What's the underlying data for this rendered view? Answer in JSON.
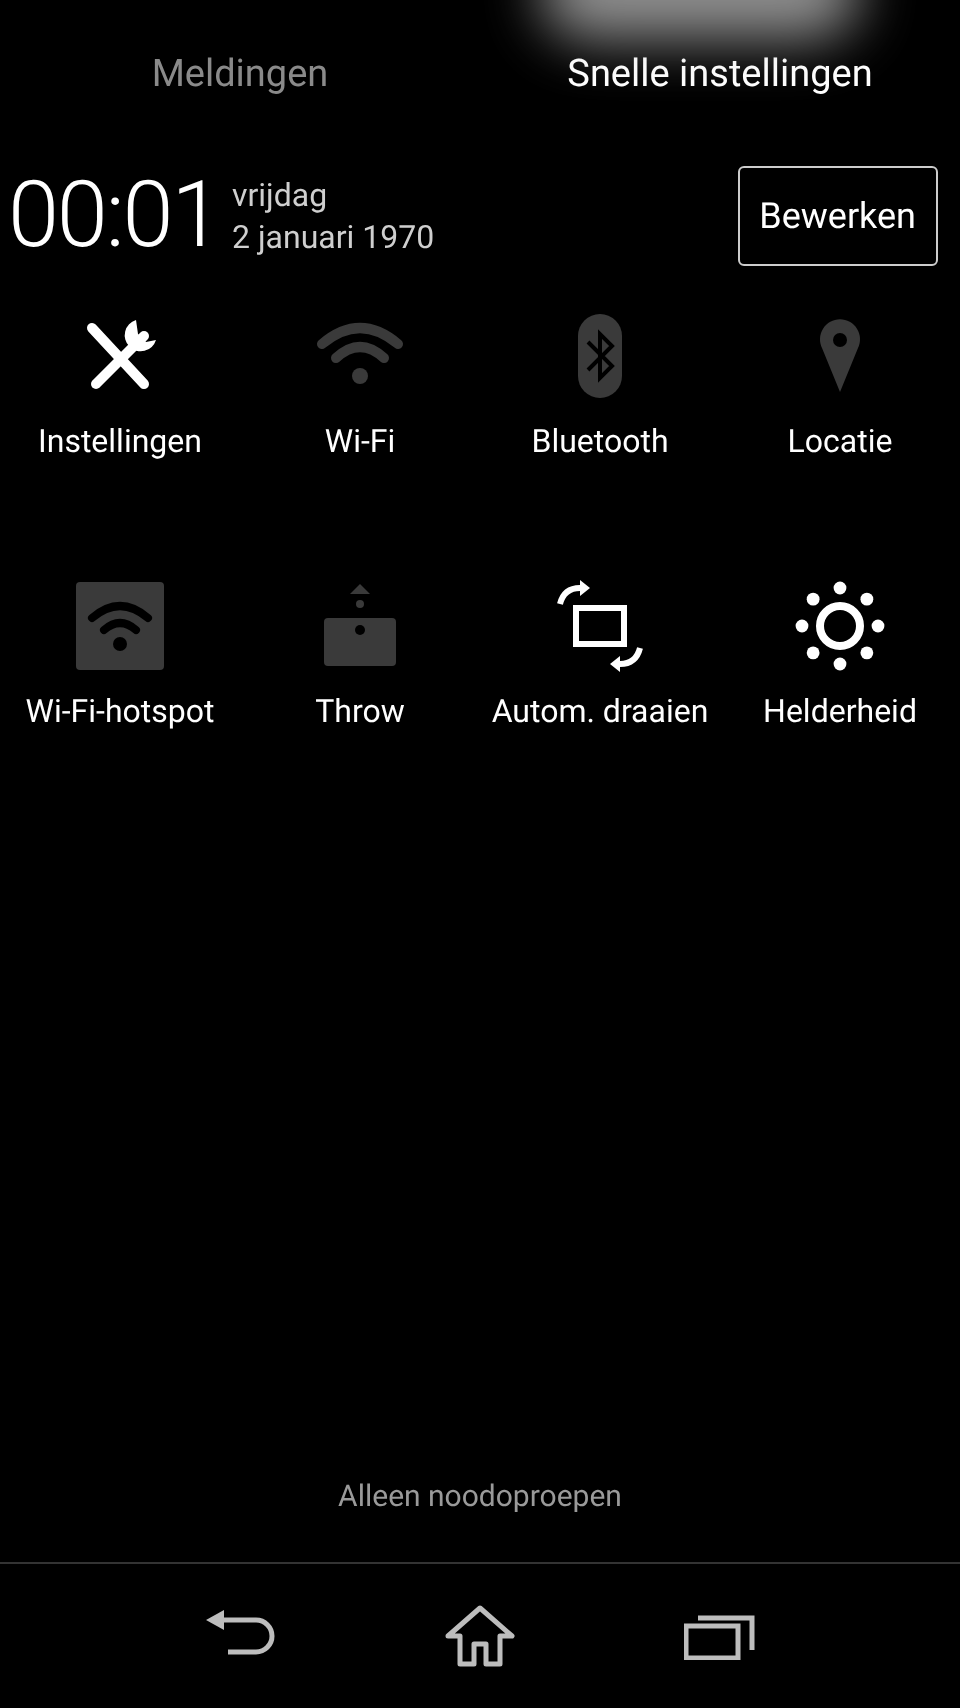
{
  "tabs": [
    {
      "label": "Meldingen",
      "selected": false
    },
    {
      "label": "Snelle instellingen",
      "selected": true
    }
  ],
  "clock": {
    "time": "00:01",
    "weekday": "vrijdag",
    "date": "2 januari 1970"
  },
  "edit_button": "Bewerken",
  "tiles": [
    {
      "kind": "settings",
      "label": "Instellingen",
      "on": true
    },
    {
      "kind": "wifi",
      "label": "Wi-Fi",
      "on": false
    },
    {
      "kind": "bluetooth",
      "label": "Bluetooth",
      "on": false
    },
    {
      "kind": "location",
      "label": "Locatie",
      "on": false
    },
    {
      "kind": "hotspot",
      "label": "Wi-Fi-hotspot",
      "on": false
    },
    {
      "kind": "throw",
      "label": "Throw",
      "on": false
    },
    {
      "kind": "rotate",
      "label": "Autom. draaien",
      "on": true
    },
    {
      "kind": "brightness",
      "label": "Helderheid",
      "on": true
    }
  ],
  "status_text": "Alleen noodoproepen"
}
